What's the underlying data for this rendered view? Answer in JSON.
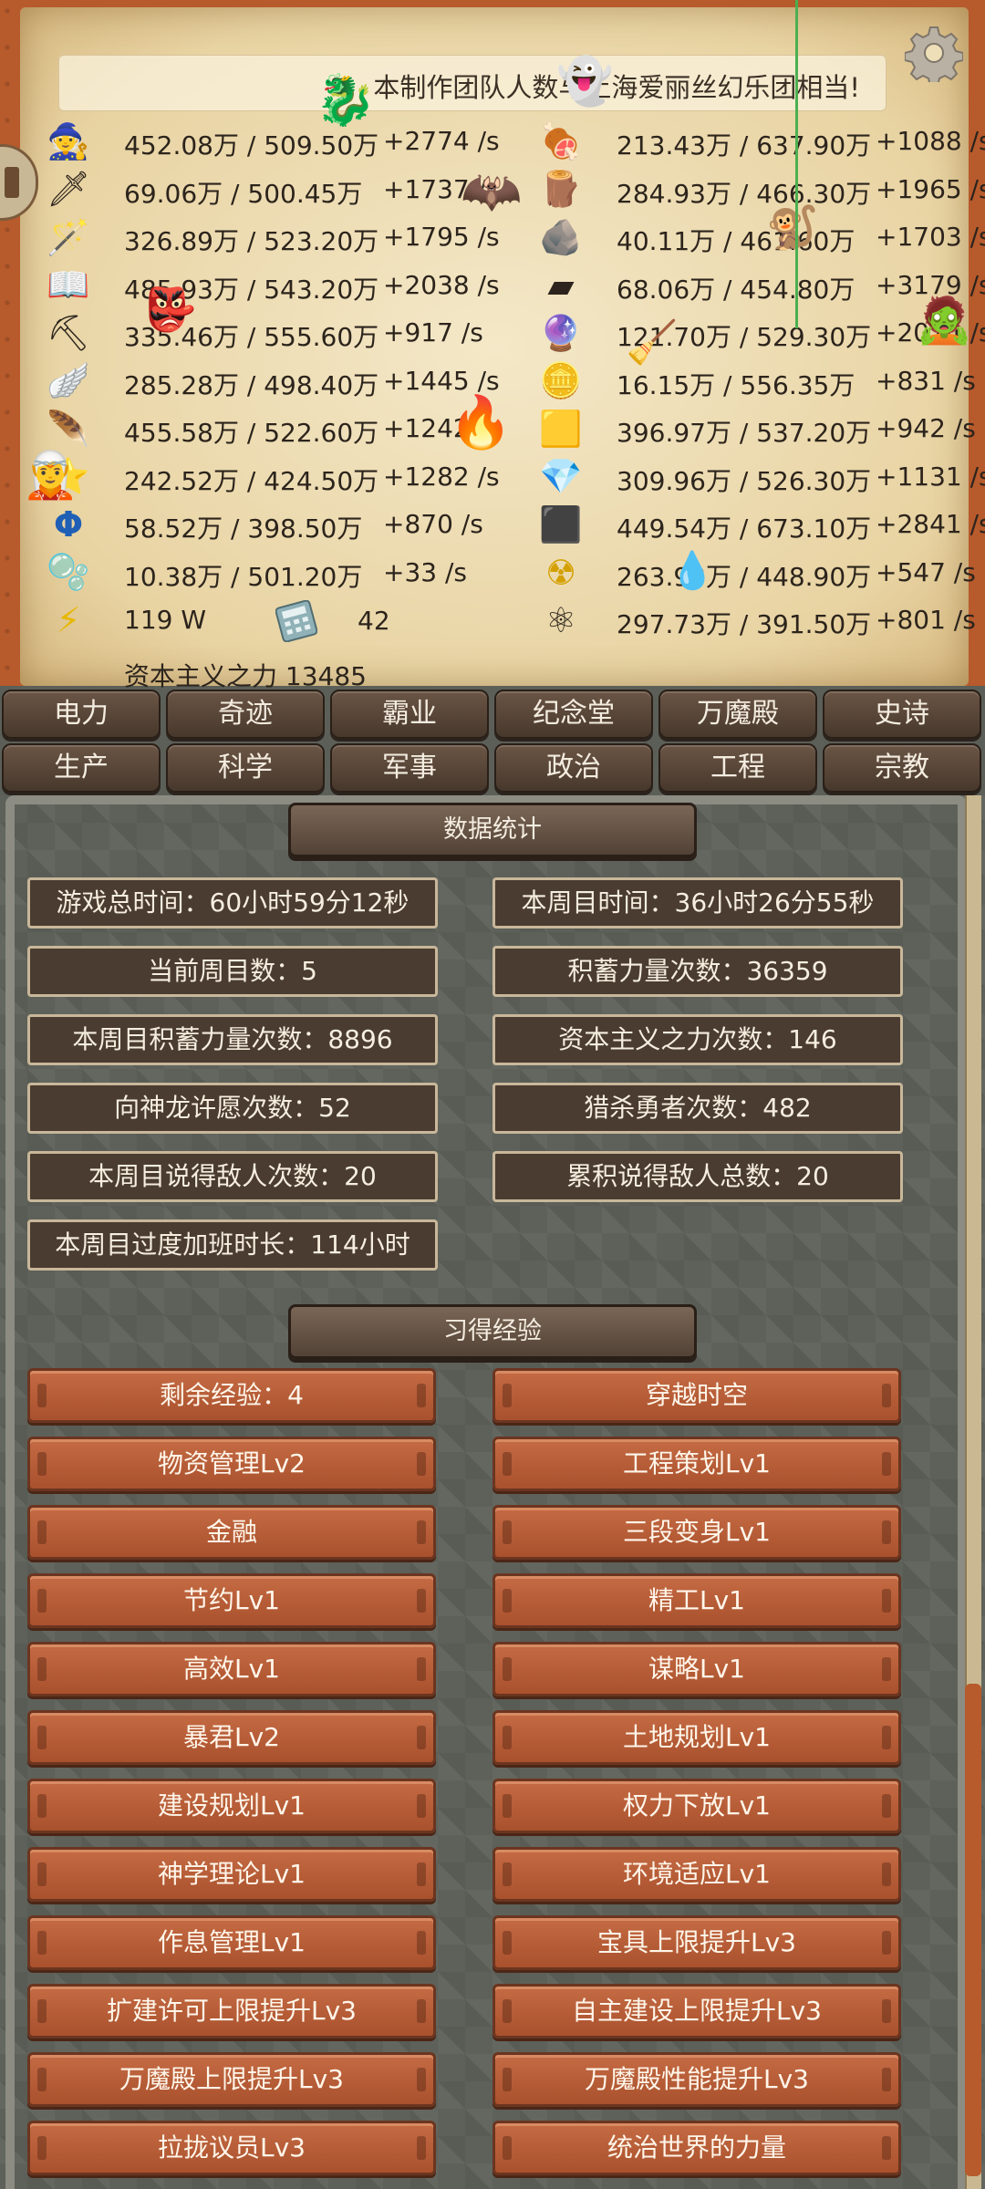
{
  "news": "本制作团队人数与上海爱丽丝幻乐团相当!",
  "resources_left": [
    {
      "icon": "wizard-hat-icon",
      "glyph": "🧙",
      "amount": "452.08万 / 509.50万",
      "rate": "+2774 /s"
    },
    {
      "icon": "sword-icon",
      "glyph": "🗡",
      "amount": "69.06万 / 500.45万",
      "rate": "+1737 /s"
    },
    {
      "icon": "wand-icon",
      "glyph": "🪄",
      "amount": "326.89万 / 523.20万",
      "rate": "+1795 /s"
    },
    {
      "icon": "book-icon",
      "glyph": "📖",
      "amount": "485.93万 / 543.20万",
      "rate": "+2038 /s"
    },
    {
      "icon": "pickaxe-icon",
      "glyph": "⛏",
      "amount": "335.46万 / 555.60万",
      "rate": "+917 /s"
    },
    {
      "icon": "wings-icon",
      "glyph": "🪽",
      "amount": "285.28万 / 498.40万",
      "rate": "+1445 /s"
    },
    {
      "icon": "feather-icon",
      "glyph": "🪶",
      "amount": "455.58万 / 522.60万",
      "rate": "+1242 /s"
    },
    {
      "icon": "star-icon",
      "glyph": "⭐",
      "amount": "242.52万 / 424.50万",
      "rate": "+1282 /s"
    },
    {
      "icon": "phi-icon",
      "glyph": "Φ",
      "amount": "58.52万 / 398.50万",
      "rate": "+870 /s"
    },
    {
      "icon": "spirit-icon",
      "glyph": "🫧",
      "amount": "10.38万 / 501.20万",
      "rate": "+33 /s"
    },
    {
      "icon": "lightning-icon",
      "glyph": "⚡",
      "amount": "119 W",
      "rate": ""
    }
  ],
  "calculator": {
    "icon": "calculator-icon",
    "value": "42"
  },
  "resources_right": [
    {
      "icon": "meat-icon",
      "glyph": "🍖",
      "amount": "213.43万 / 637.90万",
      "rate": "+1088 /s"
    },
    {
      "icon": "wood-log-icon",
      "glyph": "🪵",
      "amount": "284.93万 / 466.30万",
      "rate": "+1965 /s"
    },
    {
      "icon": "stone-icon",
      "glyph": "🪨",
      "amount": "40.11万 / 461.60万",
      "rate": "+1703 /s"
    },
    {
      "icon": "iron-ingot-icon",
      "glyph": "▰",
      "amount": "68.06万 / 454.80万",
      "rate": "+3179 /s"
    },
    {
      "icon": "crystal-icon",
      "glyph": "🔮",
      "amount": "121.70万 / 529.30万",
      "rate": "+2014 /s"
    },
    {
      "icon": "gold-coin-icon",
      "glyph": "🪙",
      "amount": "16.15万 / 556.35万",
      "rate": "+831 /s"
    },
    {
      "icon": "gold-bar-icon",
      "glyph": "🟨",
      "amount": "396.97万 / 537.20万",
      "rate": "+942 /s"
    },
    {
      "icon": "diamond-icon",
      "glyph": "💎",
      "amount": "309.96万 / 526.30万",
      "rate": "+1131 /s"
    },
    {
      "icon": "coal-icon",
      "glyph": "⬛",
      "amount": "449.54万 / 673.10万",
      "rate": "+2841 /s"
    },
    {
      "icon": "radioactive-icon",
      "glyph": "☢",
      "amount": "263.93万 / 448.90万",
      "rate": "+547 /s"
    },
    {
      "icon": "atom-icon",
      "glyph": "⚛",
      "amount": "297.73万 / 391.50万",
      "rate": "+801 /s"
    }
  ],
  "capitalism_power": "资本主义之力 13485",
  "tabs_row1": [
    "电力",
    "奇迹",
    "霸业",
    "纪念堂",
    "万魔殿",
    "史诗"
  ],
  "tabs_row2": [
    "生产",
    "科学",
    "军事",
    "政治",
    "工程",
    "宗教"
  ],
  "stats_header": "数据统计",
  "stats": [
    "游戏总时间：60小时59分12秒",
    "本周目时间：36小时26分55秒",
    "当前周目数：5",
    "积蓄力量次数：36359",
    "本周目积蓄力量次数：8896",
    "资本主义之力次数：146",
    "向神龙许愿次数：52",
    "猎杀勇者次数：482",
    "本周目说得敌人次数：20",
    "累积说得敌人总数：20",
    "本周目过度加班时长：114小时"
  ],
  "exp_header": "习得经验",
  "exp_items": [
    "剩余经验：4",
    "穿越时空",
    "物资管理Lv2",
    "工程策划Lv1",
    "金融",
    "三段变身Lv1",
    "节约Lv1",
    "精工Lv1",
    "高效Lv1",
    "谋略Lv1",
    "暴君Lv2",
    "土地规划Lv1",
    "建设规划Lv1",
    "权力下放Lv1",
    "神学理论Lv1",
    "环境适应Lv1",
    "作息管理Lv1",
    "宝具上限提升Lv3",
    "扩建许可上限提升Lv3",
    "自主建设上限提升Lv3",
    "万魔殿上限提升Lv3",
    "万魔殿性能提升Lv3",
    "拉拢议员Lv3",
    "统治世界的力量"
  ]
}
